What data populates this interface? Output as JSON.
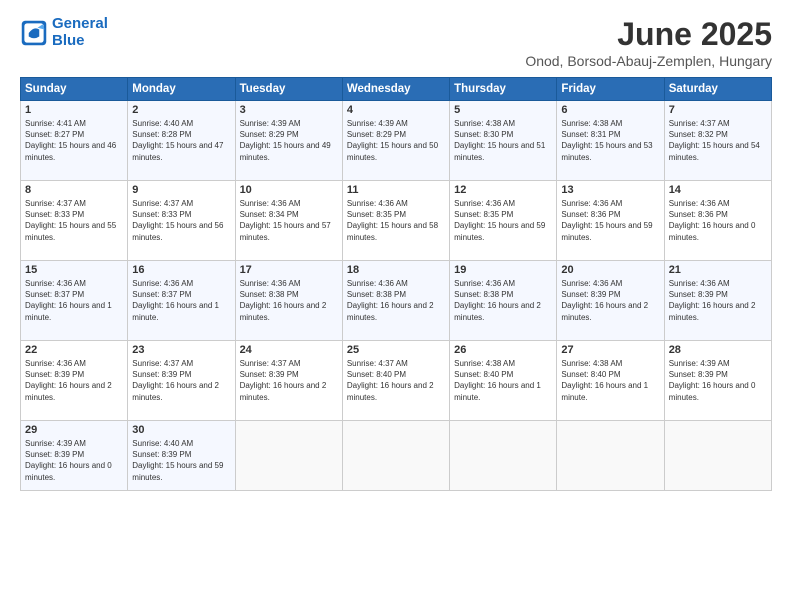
{
  "logo": {
    "line1": "General",
    "line2": "Blue"
  },
  "title": "June 2025",
  "subtitle": "Onod, Borsod-Abauj-Zemplen, Hungary",
  "headers": [
    "Sunday",
    "Monday",
    "Tuesday",
    "Wednesday",
    "Thursday",
    "Friday",
    "Saturday"
  ],
  "weeks": [
    [
      {
        "day": "1",
        "sunrise": "4:41 AM",
        "sunset": "8:27 PM",
        "daylight": "15 hours and 46 minutes."
      },
      {
        "day": "2",
        "sunrise": "4:40 AM",
        "sunset": "8:28 PM",
        "daylight": "15 hours and 47 minutes."
      },
      {
        "day": "3",
        "sunrise": "4:39 AM",
        "sunset": "8:29 PM",
        "daylight": "15 hours and 49 minutes."
      },
      {
        "day": "4",
        "sunrise": "4:39 AM",
        "sunset": "8:29 PM",
        "daylight": "15 hours and 50 minutes."
      },
      {
        "day": "5",
        "sunrise": "4:38 AM",
        "sunset": "8:30 PM",
        "daylight": "15 hours and 51 minutes."
      },
      {
        "day": "6",
        "sunrise": "4:38 AM",
        "sunset": "8:31 PM",
        "daylight": "15 hours and 53 minutes."
      },
      {
        "day": "7",
        "sunrise": "4:37 AM",
        "sunset": "8:32 PM",
        "daylight": "15 hours and 54 minutes."
      }
    ],
    [
      {
        "day": "8",
        "sunrise": "4:37 AM",
        "sunset": "8:33 PM",
        "daylight": "15 hours and 55 minutes."
      },
      {
        "day": "9",
        "sunrise": "4:37 AM",
        "sunset": "8:33 PM",
        "daylight": "15 hours and 56 minutes."
      },
      {
        "day": "10",
        "sunrise": "4:36 AM",
        "sunset": "8:34 PM",
        "daylight": "15 hours and 57 minutes."
      },
      {
        "day": "11",
        "sunrise": "4:36 AM",
        "sunset": "8:35 PM",
        "daylight": "15 hours and 58 minutes."
      },
      {
        "day": "12",
        "sunrise": "4:36 AM",
        "sunset": "8:35 PM",
        "daylight": "15 hours and 59 minutes."
      },
      {
        "day": "13",
        "sunrise": "4:36 AM",
        "sunset": "8:36 PM",
        "daylight": "15 hours and 59 minutes."
      },
      {
        "day": "14",
        "sunrise": "4:36 AM",
        "sunset": "8:36 PM",
        "daylight": "16 hours and 0 minutes."
      }
    ],
    [
      {
        "day": "15",
        "sunrise": "4:36 AM",
        "sunset": "8:37 PM",
        "daylight": "16 hours and 1 minute."
      },
      {
        "day": "16",
        "sunrise": "4:36 AM",
        "sunset": "8:37 PM",
        "daylight": "16 hours and 1 minute."
      },
      {
        "day": "17",
        "sunrise": "4:36 AM",
        "sunset": "8:38 PM",
        "daylight": "16 hours and 2 minutes."
      },
      {
        "day": "18",
        "sunrise": "4:36 AM",
        "sunset": "8:38 PM",
        "daylight": "16 hours and 2 minutes."
      },
      {
        "day": "19",
        "sunrise": "4:36 AM",
        "sunset": "8:38 PM",
        "daylight": "16 hours and 2 minutes."
      },
      {
        "day": "20",
        "sunrise": "4:36 AM",
        "sunset": "8:39 PM",
        "daylight": "16 hours and 2 minutes."
      },
      {
        "day": "21",
        "sunrise": "4:36 AM",
        "sunset": "8:39 PM",
        "daylight": "16 hours and 2 minutes."
      }
    ],
    [
      {
        "day": "22",
        "sunrise": "4:36 AM",
        "sunset": "8:39 PM",
        "daylight": "16 hours and 2 minutes."
      },
      {
        "day": "23",
        "sunrise": "4:37 AM",
        "sunset": "8:39 PM",
        "daylight": "16 hours and 2 minutes."
      },
      {
        "day": "24",
        "sunrise": "4:37 AM",
        "sunset": "8:39 PM",
        "daylight": "16 hours and 2 minutes."
      },
      {
        "day": "25",
        "sunrise": "4:37 AM",
        "sunset": "8:40 PM",
        "daylight": "16 hours and 2 minutes."
      },
      {
        "day": "26",
        "sunrise": "4:38 AM",
        "sunset": "8:40 PM",
        "daylight": "16 hours and 1 minute."
      },
      {
        "day": "27",
        "sunrise": "4:38 AM",
        "sunset": "8:40 PM",
        "daylight": "16 hours and 1 minute."
      },
      {
        "day": "28",
        "sunrise": "4:39 AM",
        "sunset": "8:39 PM",
        "daylight": "16 hours and 0 minutes."
      }
    ],
    [
      {
        "day": "29",
        "sunrise": "4:39 AM",
        "sunset": "8:39 PM",
        "daylight": "16 hours and 0 minutes."
      },
      {
        "day": "30",
        "sunrise": "4:40 AM",
        "sunset": "8:39 PM",
        "daylight": "15 hours and 59 minutes."
      },
      null,
      null,
      null,
      null,
      null
    ]
  ]
}
